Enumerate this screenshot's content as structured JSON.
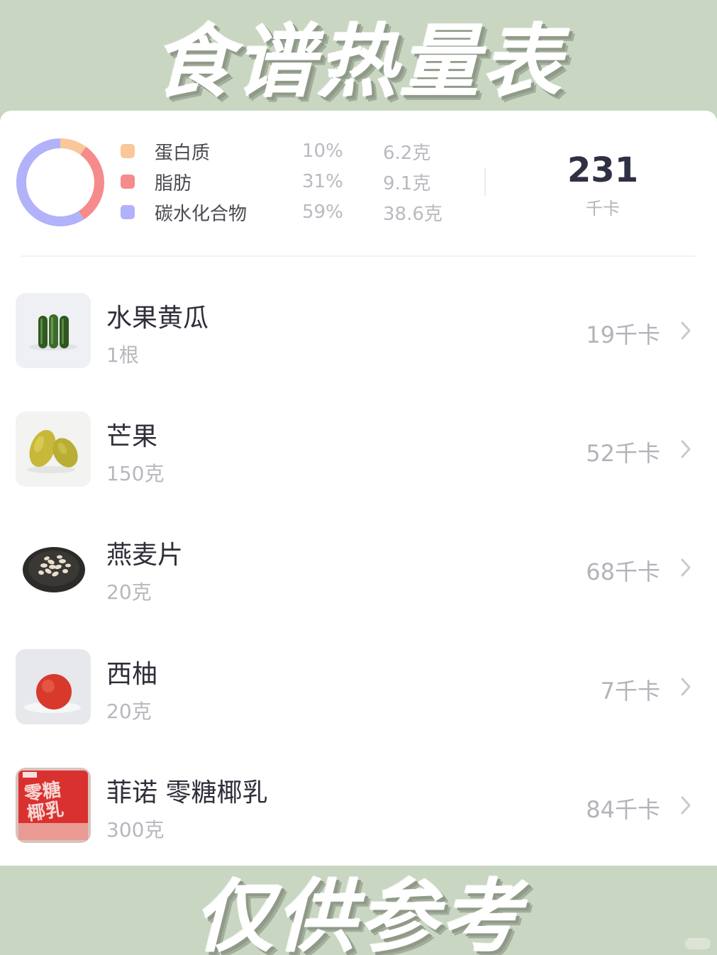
{
  "header": {
    "title": "食谱热量表"
  },
  "footer": {
    "note": "仅供参考"
  },
  "summary": {
    "chart_data": {
      "type": "pie",
      "variant": "donut",
      "labels": [
        "蛋白质",
        "脂肪",
        "碳水化合物"
      ],
      "values": [
        10,
        31,
        59
      ],
      "colors": [
        "#f9c79a",
        "#f58b8b",
        "#b1b2fa"
      ]
    },
    "macros": [
      {
        "name": "蛋白质",
        "percent": "10%",
        "amount": "6.2克",
        "color": "#f9c79a"
      },
      {
        "name": "脂肪",
        "percent": "31%",
        "amount": "9.1克",
        "color": "#f58b8b"
      },
      {
        "name": "碳水化合物",
        "percent": "59%",
        "amount": "38.6克",
        "color": "#b1b2fa"
      }
    ],
    "total_calories": "231",
    "total_unit": "千卡"
  },
  "foods": [
    {
      "name": "水果黄瓜",
      "qty": "1根",
      "kcal": "19千卡",
      "icon": "cucumber-icon"
    },
    {
      "name": "芒果",
      "qty": "150克",
      "kcal": "52千卡",
      "icon": "mango-icon"
    },
    {
      "name": "燕麦片",
      "qty": "20克",
      "kcal": "68千卡",
      "icon": "oatmeal-icon"
    },
    {
      "name": "西柚",
      "qty": "20克",
      "kcal": "7千卡",
      "icon": "grapefruit-icon"
    },
    {
      "name": "菲诺 零糖椰乳",
      "qty": "300克",
      "kcal": "84千卡",
      "icon": "coconut-milk-box-icon",
      "package_text": "零糖椰乳"
    }
  ]
}
